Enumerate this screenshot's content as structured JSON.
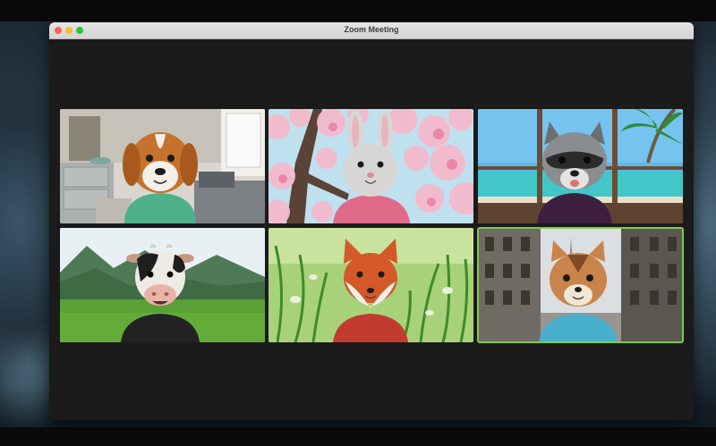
{
  "window": {
    "title": "Zoom Meeting"
  },
  "colors": {
    "active_speaker": "#7ecb4c",
    "stage_background": "#1b1b1b",
    "titlebar": "#e0e0e0"
  },
  "participants": [
    {
      "avatar": "dog-avatar",
      "background": "living-room-background",
      "shirt": "#4fb08c",
      "active": false
    },
    {
      "avatar": "bunny-avatar",
      "background": "cherry-blossom-background",
      "shirt": "#e06a8a",
      "active": false
    },
    {
      "avatar": "raccoon-avatar",
      "background": "tropical-beach-background",
      "shirt": "#3c1f3f",
      "active": false
    },
    {
      "avatar": "cow-avatar",
      "background": "mountain-meadow-background",
      "shirt": "#222222",
      "active": false
    },
    {
      "avatar": "fox-avatar",
      "background": "grass-field-background",
      "shirt": "#c23b2e",
      "active": false
    },
    {
      "avatar": "cat-avatar",
      "background": "paris-street-background",
      "shirt": "#48b0cc",
      "active": true
    }
  ]
}
